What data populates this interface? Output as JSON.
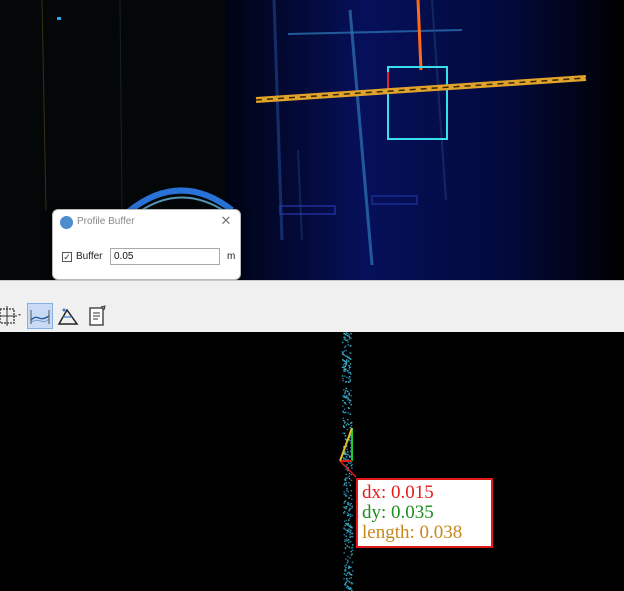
{
  "dialog": {
    "title": "Profile Buffer",
    "close_glyph": "✕",
    "buffer_label": "Buffer",
    "buffer_checked": true,
    "buffer_value": "0.05",
    "unit": "m"
  },
  "toolbar": {
    "buttons": [
      {
        "name": "crosshair-grid-icon",
        "active": false
      },
      {
        "name": "profile-view-icon",
        "active": true
      },
      {
        "name": "terrain-profile-icon",
        "active": false
      },
      {
        "name": "notes-icon",
        "active": false
      }
    ]
  },
  "measurement": {
    "dx": "dx: 0.015",
    "dy": "dy: 0.035",
    "length": "length: 0.038"
  },
  "colors": {
    "dx": "#e41a1a",
    "dy": "#1d8c1d",
    "length": "#c8871a",
    "profile_line": "#e0a22a",
    "selection_box": "#37e0ef"
  }
}
